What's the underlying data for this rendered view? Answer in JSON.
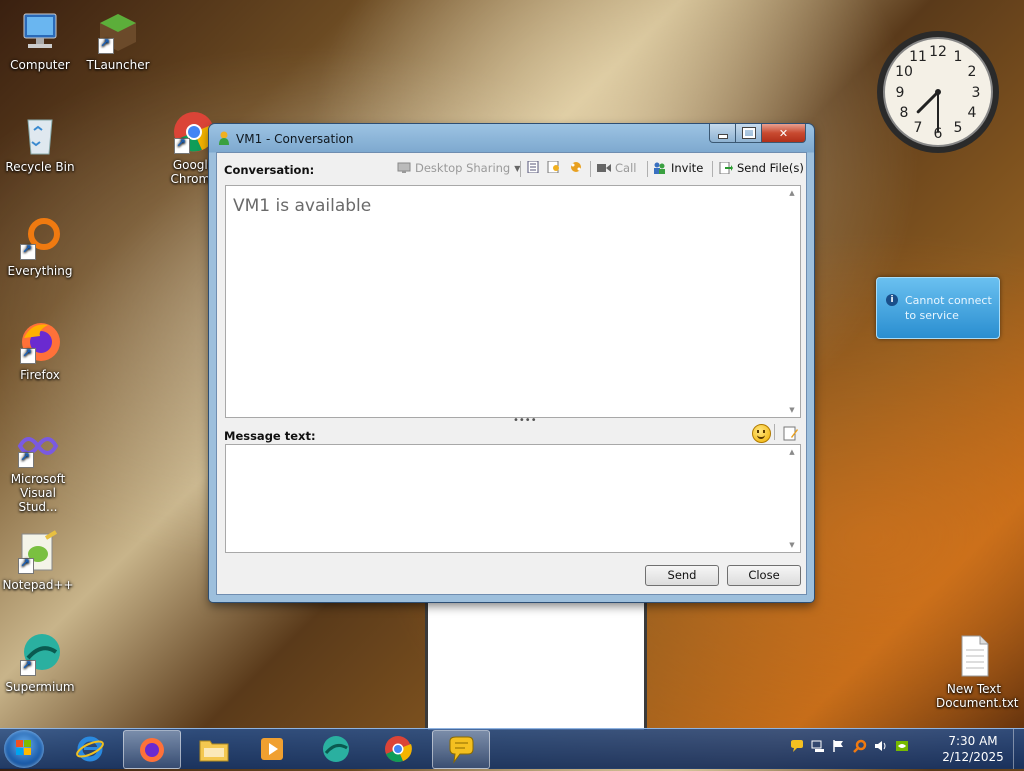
{
  "desktop": {
    "icons": [
      {
        "label": "Computer"
      },
      {
        "label": "TLauncher"
      },
      {
        "label": "Recycle Bin"
      },
      {
        "label": "Google Chrome"
      },
      {
        "label": "Everything"
      },
      {
        "label": "Firefox"
      },
      {
        "label": "Microsoft Visual Stud..."
      },
      {
        "label": "Notepad++"
      },
      {
        "label": "Supermium"
      },
      {
        "label": "New Text Document.txt"
      }
    ],
    "clock_gadget": {
      "hour": 7,
      "minute": 30
    },
    "notice_gadget": {
      "text": "Cannot connect to service",
      "icon": "info-icon"
    }
  },
  "window": {
    "title": "VM1 - Conversation",
    "conversation_label": "Conversation:",
    "toolbar": {
      "desktop_sharing": "Desktop Sharing",
      "call": "Call",
      "invite": "Invite",
      "send_files": "Send File(s)"
    },
    "status_message": "VM1 is available",
    "message_label": "Message text:",
    "message_value": "",
    "send_label": "Send",
    "close_label": "Close"
  },
  "taskbar": {
    "apps": [
      "Internet Explorer",
      "Firefox",
      "File Explorer",
      "Media Player",
      "Supermium",
      "Google Chrome",
      "Messenger"
    ],
    "active_app": "Messenger",
    "time": "7:30 AM",
    "date": "2/12/2025"
  }
}
